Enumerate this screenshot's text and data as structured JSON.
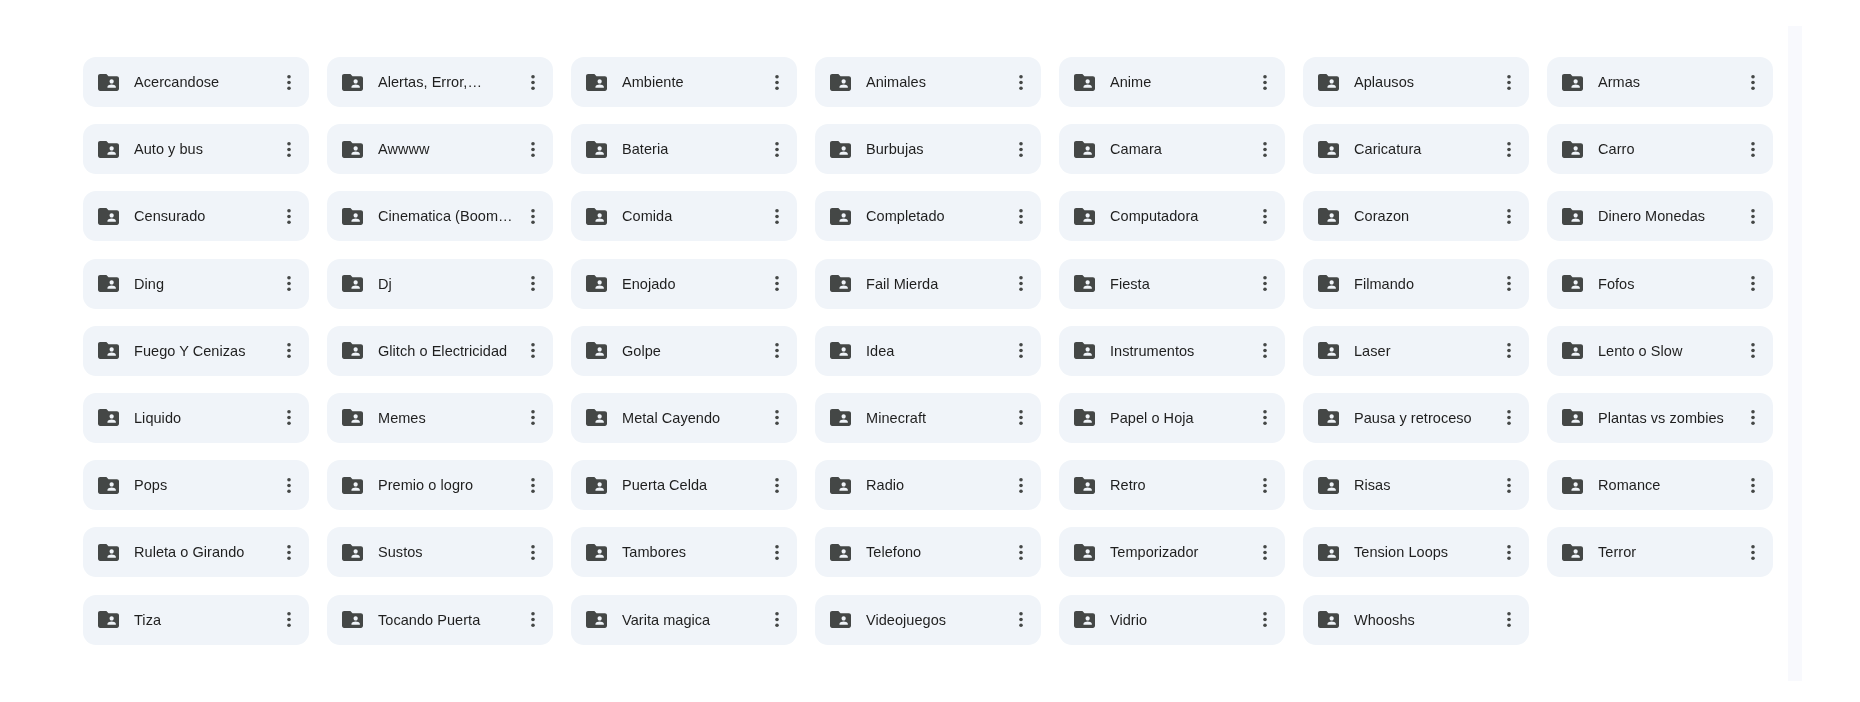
{
  "folders": [
    {
      "name": "Acercandose"
    },
    {
      "name": "Alertas, Error,…"
    },
    {
      "name": "Ambiente"
    },
    {
      "name": "Animales"
    },
    {
      "name": "Anime"
    },
    {
      "name": "Aplausos"
    },
    {
      "name": "Armas"
    },
    {
      "name": "Auto y bus"
    },
    {
      "name": "Awwww"
    },
    {
      "name": "Bateria"
    },
    {
      "name": "Burbujas"
    },
    {
      "name": "Camara"
    },
    {
      "name": "Caricatura"
    },
    {
      "name": "Carro"
    },
    {
      "name": "Censurado"
    },
    {
      "name": "Cinematica (Boom…"
    },
    {
      "name": "Comida"
    },
    {
      "name": "Completado"
    },
    {
      "name": "Computadora"
    },
    {
      "name": "Corazon"
    },
    {
      "name": "Dinero Monedas"
    },
    {
      "name": "Ding"
    },
    {
      "name": "Dj"
    },
    {
      "name": "Enojado"
    },
    {
      "name": "Fail Mierda"
    },
    {
      "name": "Fiesta"
    },
    {
      "name": "Filmando"
    },
    {
      "name": "Fofos"
    },
    {
      "name": "Fuego Y Cenizas"
    },
    {
      "name": "Glitch o Electricidad"
    },
    {
      "name": "Golpe"
    },
    {
      "name": "Idea"
    },
    {
      "name": "Instrumentos"
    },
    {
      "name": "Laser"
    },
    {
      "name": "Lento o Slow"
    },
    {
      "name": "Liquido"
    },
    {
      "name": "Memes"
    },
    {
      "name": "Metal Cayendo"
    },
    {
      "name": "Minecraft"
    },
    {
      "name": "Papel o Hoja"
    },
    {
      "name": "Pausa y retroceso"
    },
    {
      "name": "Plantas vs zombies"
    },
    {
      "name": "Pops"
    },
    {
      "name": "Premio o logro"
    },
    {
      "name": "Puerta Celda"
    },
    {
      "name": "Radio"
    },
    {
      "name": "Retro"
    },
    {
      "name": "Risas"
    },
    {
      "name": "Romance"
    },
    {
      "name": "Ruleta o Girando"
    },
    {
      "name": "Sustos"
    },
    {
      "name": "Tambores"
    },
    {
      "name": "Telefono"
    },
    {
      "name": "Temporizador"
    },
    {
      "name": "Tension Loops"
    },
    {
      "name": "Terror"
    },
    {
      "name": "Tiza"
    },
    {
      "name": "Tocando Puerta"
    },
    {
      "name": "Varita magica"
    },
    {
      "name": "Videojuegos"
    },
    {
      "name": "Vidrio"
    },
    {
      "name": "Whooshs"
    }
  ]
}
